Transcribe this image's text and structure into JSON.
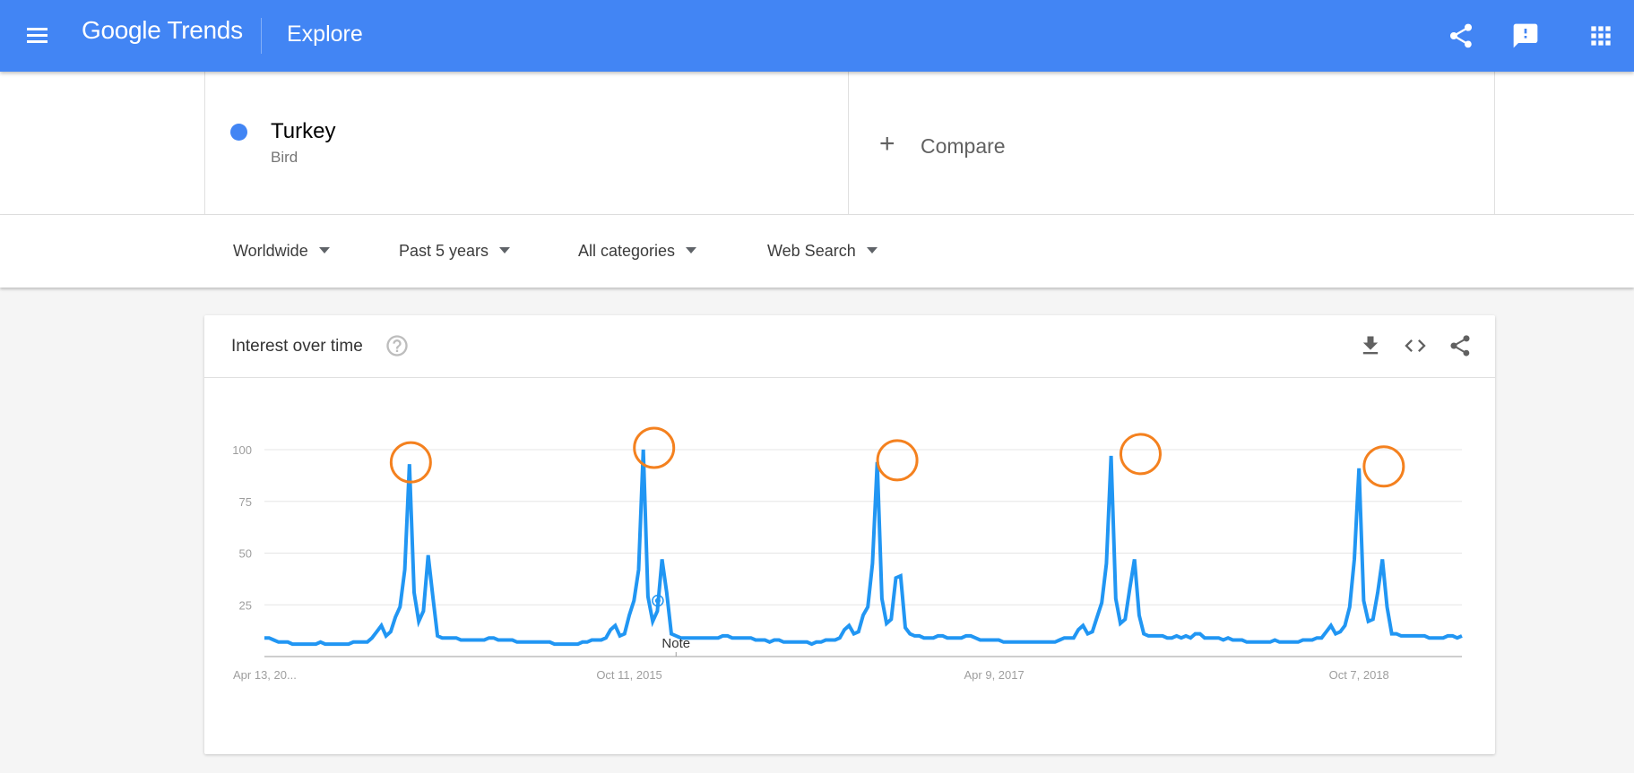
{
  "app": {
    "logo": "Google Trends",
    "page": "Explore",
    "brand_color": "#4285f4"
  },
  "header_icons": [
    "share-icon",
    "feedback-icon",
    "apps-grid-icon"
  ],
  "search": {
    "term": "Turkey",
    "term_category": "Bird",
    "term_color": "#4285f4",
    "compare_label": "Compare"
  },
  "filters": [
    {
      "label": "Worldwide"
    },
    {
      "label": "Past 5 years"
    },
    {
      "label": "All categories"
    },
    {
      "label": "Web Search"
    }
  ],
  "card": {
    "title": "Interest over time",
    "icons": [
      "download-icon",
      "embed-code-icon",
      "share-icon"
    ]
  },
  "chart_data": {
    "type": "line",
    "title": "Interest over time",
    "xlabel": "",
    "ylabel": "",
    "ylim": [
      0,
      100
    ],
    "yticks": [
      25,
      50,
      75,
      100
    ],
    "grid": true,
    "x_tick_labels": [
      {
        "label": "Apr 13, 20...",
        "week": 0
      },
      {
        "label": "Oct 11, 2015",
        "week": 78
      },
      {
        "label": "Apr 9, 2017",
        "week": 156
      },
      {
        "label": "Oct 7, 2018",
        "week": 234
      }
    ],
    "note": {
      "label": "Note",
      "week": 88
    },
    "series": [
      {
        "name": "Turkey",
        "color": "#2196f3",
        "frequency": "weekly",
        "values": [
          9,
          9,
          8,
          7,
          7,
          7,
          6,
          6,
          6,
          6,
          6,
          6,
          7,
          6,
          6,
          6,
          6,
          6,
          6,
          7,
          7,
          7,
          7,
          9,
          12,
          15,
          10,
          12,
          19,
          24,
          42,
          93,
          31,
          17,
          22,
          49,
          29,
          10,
          9,
          9,
          9,
          9,
          8,
          8,
          8,
          8,
          8,
          8,
          9,
          9,
          8,
          8,
          8,
          8,
          7,
          7,
          7,
          7,
          7,
          7,
          7,
          7,
          6,
          6,
          6,
          6,
          6,
          6,
          7,
          7,
          8,
          8,
          8,
          9,
          13,
          15,
          10,
          11,
          20,
          27,
          42,
          100,
          29,
          17,
          22,
          47,
          31,
          11,
          10,
          9,
          9,
          9,
          9,
          9,
          9,
          9,
          9,
          9,
          10,
          10,
          9,
          9,
          9,
          9,
          9,
          8,
          8,
          8,
          7,
          8,
          8,
          7,
          7,
          7,
          7,
          7,
          7,
          6,
          7,
          7,
          8,
          8,
          8,
          9,
          13,
          15,
          11,
          12,
          20,
          24,
          45,
          94,
          28,
          16,
          18,
          38,
          39,
          14,
          11,
          10,
          10,
          9,
          9,
          9,
          10,
          10,
          9,
          9,
          9,
          9,
          10,
          10,
          9,
          8,
          8,
          8,
          8,
          8,
          7,
          7,
          7,
          7,
          7,
          7,
          7,
          7,
          7,
          7,
          7,
          7,
          8,
          9,
          9,
          9,
          13,
          15,
          11,
          12,
          19,
          26,
          45,
          97,
          28,
          16,
          18,
          33,
          47,
          20,
          11,
          10,
          10,
          10,
          10,
          9,
          9,
          10,
          9,
          10,
          9,
          11,
          11,
          9,
          9,
          9,
          9,
          8,
          9,
          8,
          8,
          8,
          7,
          7,
          7,
          7,
          7,
          7,
          8,
          7,
          7,
          7,
          7,
          7,
          8,
          8,
          8,
          9,
          9,
          12,
          15,
          11,
          12,
          15,
          24,
          47,
          91,
          27,
          17,
          18,
          31,
          47,
          24,
          11,
          11,
          10,
          10,
          10,
          10,
          10,
          10,
          9,
          9,
          9,
          9,
          10,
          10,
          9,
          10
        ]
      }
    ],
    "annotations": [
      {
        "type": "highlight-circle",
        "color": "#f4811f",
        "week": 31,
        "value": 93
      },
      {
        "type": "highlight-circle",
        "color": "#f4811f",
        "week": 83,
        "value": 100
      },
      {
        "type": "highlight-circle",
        "color": "#f4811f",
        "week": 135,
        "value": 94
      },
      {
        "type": "highlight-circle",
        "color": "#f4811f",
        "week": 187,
        "value": 97
      },
      {
        "type": "highlight-circle",
        "color": "#f4811f",
        "week": 239,
        "value": 91
      }
    ]
  }
}
